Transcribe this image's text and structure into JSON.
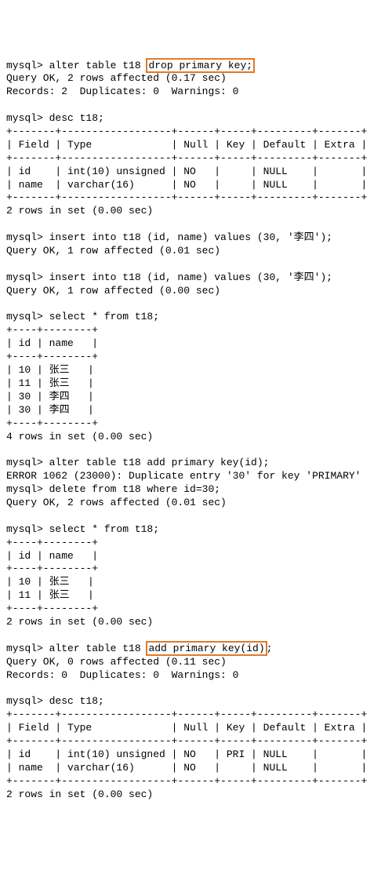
{
  "lines": [
    {
      "t": "prompt",
      "prefix": "mysql> ",
      "before": "alter table t18 ",
      "hl": "drop primary key;",
      "after": ""
    },
    {
      "t": "plain",
      "text": "Query OK, 2 rows affected (0.17 sec)"
    },
    {
      "t": "plain",
      "text": "Records: 2  Duplicates: 0  Warnings: 0"
    },
    {
      "t": "blank"
    },
    {
      "t": "plain",
      "text": "mysql> desc t18;"
    },
    {
      "t": "plain",
      "text": "+-------+------------------+------+-----+---------+-------+"
    },
    {
      "t": "plain",
      "text": "| Field | Type             | Null | Key | Default | Extra |"
    },
    {
      "t": "plain",
      "text": "+-------+------------------+------+-----+---------+-------+"
    },
    {
      "t": "plain",
      "text": "| id    | int(10) unsigned | NO   |     | NULL    |       |"
    },
    {
      "t": "plain",
      "text": "| name  | varchar(16)      | NO   |     | NULL    |       |"
    },
    {
      "t": "plain",
      "text": "+-------+------------------+------+-----+---------+-------+"
    },
    {
      "t": "plain",
      "text": "2 rows in set (0.00 sec)"
    },
    {
      "t": "blank"
    },
    {
      "t": "plain",
      "text": "mysql> insert into t18 (id, name) values (30, '李四');"
    },
    {
      "t": "plain",
      "text": "Query OK, 1 row affected (0.01 sec)"
    },
    {
      "t": "blank"
    },
    {
      "t": "plain",
      "text": "mysql> insert into t18 (id, name) values (30, '李四');"
    },
    {
      "t": "plain",
      "text": "Query OK, 1 row affected (0.00 sec)"
    },
    {
      "t": "blank"
    },
    {
      "t": "plain",
      "text": "mysql> select * from t18;"
    },
    {
      "t": "plain",
      "text": "+----+--------+"
    },
    {
      "t": "plain",
      "text": "| id | name   |"
    },
    {
      "t": "plain",
      "text": "+----+--------+"
    },
    {
      "t": "plain",
      "text": "| 10 | 张三   |"
    },
    {
      "t": "plain",
      "text": "| 11 | 张三   |"
    },
    {
      "t": "plain",
      "text": "| 30 | 李四   |"
    },
    {
      "t": "plain",
      "text": "| 30 | 李四   |"
    },
    {
      "t": "plain",
      "text": "+----+--------+"
    },
    {
      "t": "plain",
      "text": "4 rows in set (0.00 sec)"
    },
    {
      "t": "blank"
    },
    {
      "t": "plain",
      "text": "mysql> alter table t18 add primary key(id);"
    },
    {
      "t": "plain",
      "text": "ERROR 1062 (23000): Duplicate entry '30' for key 'PRIMARY'"
    },
    {
      "t": "plain",
      "text": "mysql> delete from t18 where id=30;"
    },
    {
      "t": "plain",
      "text": "Query OK, 2 rows affected (0.01 sec)"
    },
    {
      "t": "blank"
    },
    {
      "t": "plain",
      "text": "mysql> select * from t18;"
    },
    {
      "t": "plain",
      "text": "+----+--------+"
    },
    {
      "t": "plain",
      "text": "| id | name   |"
    },
    {
      "t": "plain",
      "text": "+----+--------+"
    },
    {
      "t": "plain",
      "text": "| 10 | 张三   |"
    },
    {
      "t": "plain",
      "text": "| 11 | 张三   |"
    },
    {
      "t": "plain",
      "text": "+----+--------+"
    },
    {
      "t": "plain",
      "text": "2 rows in set (0.00 sec)"
    },
    {
      "t": "blank"
    },
    {
      "t": "prompt",
      "prefix": "mysql> ",
      "before": "alter table t18 ",
      "hl": "add primary key(id)",
      "after": ";"
    },
    {
      "t": "plain",
      "text": "Query OK, 0 rows affected (0.11 sec)"
    },
    {
      "t": "plain",
      "text": "Records: 0  Duplicates: 0  Warnings: 0"
    },
    {
      "t": "blank"
    },
    {
      "t": "plain",
      "text": "mysql> desc t18;"
    },
    {
      "t": "plain",
      "text": "+-------+------------------+------+-----+---------+-------+"
    },
    {
      "t": "plain",
      "text": "| Field | Type             | Null | Key | Default | Extra |"
    },
    {
      "t": "plain",
      "text": "+-------+------------------+------+-----+---------+-------+"
    },
    {
      "t": "plain",
      "text": "| id    | int(10) unsigned | NO   | PRI | NULL    |       |"
    },
    {
      "t": "plain",
      "text": "| name  | varchar(16)      | NO   |     | NULL    |       |"
    },
    {
      "t": "plain",
      "text": "+-------+------------------+------+-----+---------+-------+"
    },
    {
      "t": "plain",
      "text": "2 rows in set (0.00 sec)"
    }
  ]
}
